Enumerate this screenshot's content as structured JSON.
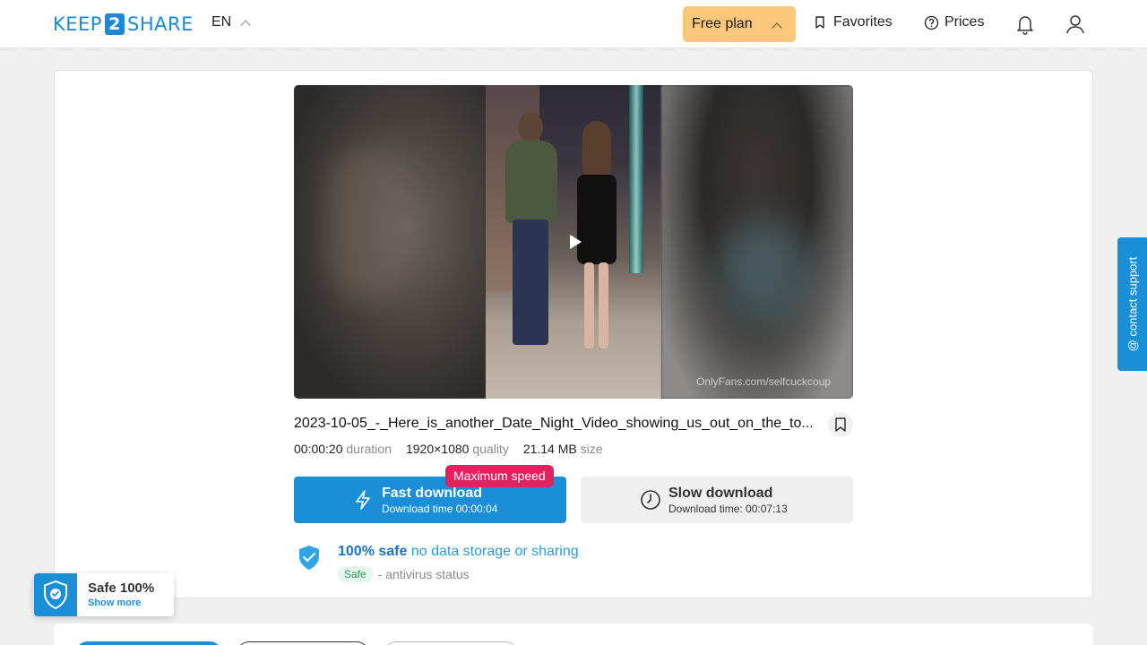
{
  "header": {
    "logo_left": "KEEP",
    "logo_mid": "2",
    "logo_right": "SHARE",
    "language": "EN",
    "free_plan": "Free plan",
    "favorites": "Favorites",
    "prices": "Prices"
  },
  "video": {
    "watermark": "OnlyFans.com/selfcuckcoup"
  },
  "file": {
    "name": "2023-10-05_-_Here_is_another_Date_Night_Video_showing_us_out_on_the_to...",
    "duration_value": "00:00:20",
    "duration_label": "duration",
    "quality_value": "1920×1080",
    "quality_label": "quality",
    "size_value": "21.14 MB",
    "size_label": "size"
  },
  "download": {
    "badge": "Maximum speed",
    "fast_title": "Fast download",
    "fast_sub": "Download time 00:00:04",
    "slow_title": "Slow download",
    "slow_sub": "Download time: 00:07:13"
  },
  "safety": {
    "title_bold": "100% safe",
    "title_rest": "no data storage or sharing",
    "status_pill": "Safe",
    "status_text": "- antivirus status"
  },
  "support": {
    "label": "@ contact support"
  },
  "safe_widget": {
    "title": "Safe 100%",
    "link": "Show more"
  },
  "colors": {
    "accent": "#1a8fd8",
    "free_plan_bg": "#fbc77a",
    "badge": "#e2215f"
  }
}
